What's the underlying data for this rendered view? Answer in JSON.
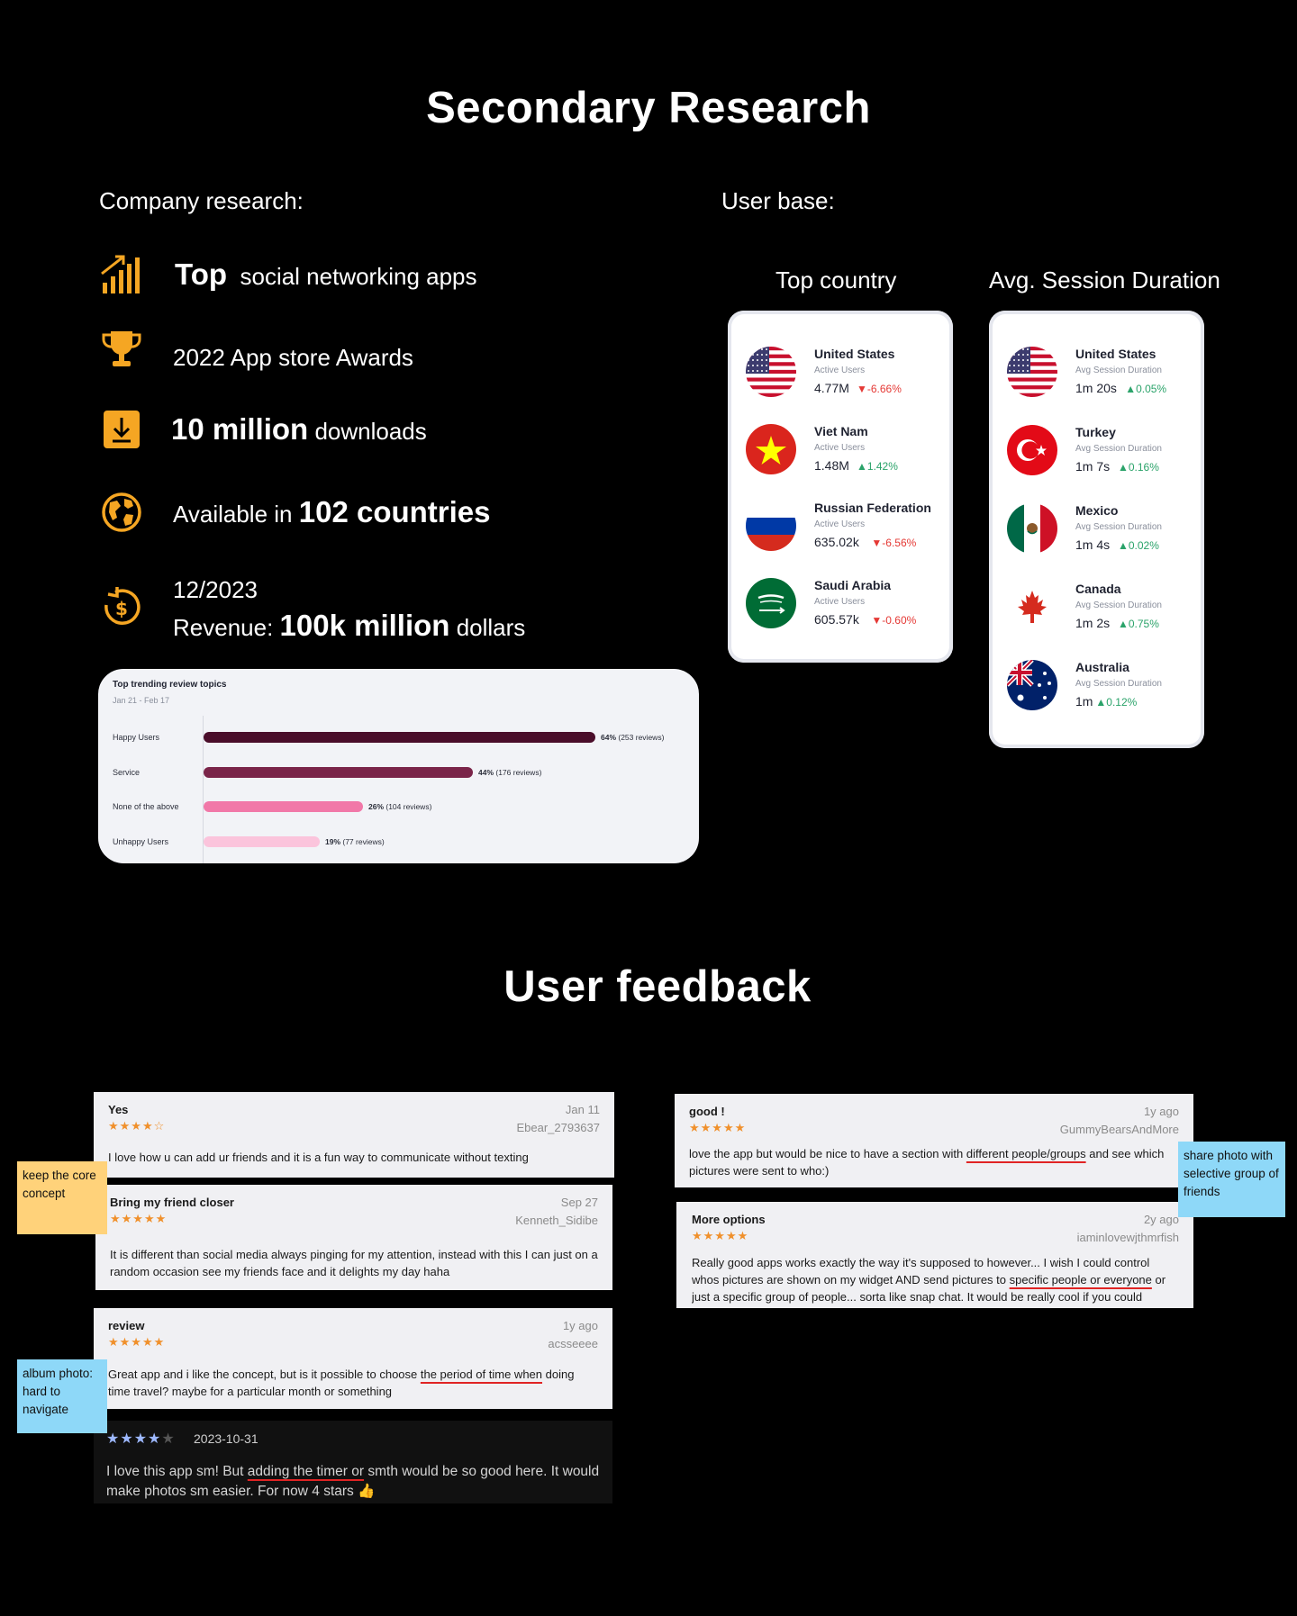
{
  "secondary": {
    "title": "Secondary Research",
    "company_label": "Company research:",
    "userbase_label": "User base:",
    "company_items": [
      {
        "icon": "growth-chart-icon",
        "bold": "Top",
        "text": "social networking apps"
      },
      {
        "icon": "trophy-icon",
        "text": "2022 App store Awards"
      },
      {
        "icon": "download-icon",
        "bold": "10 million",
        "text": "downloads"
      },
      {
        "icon": "globe-icon",
        "prefix": "Available in",
        "bold": "102 countries"
      },
      {
        "icon": "revenue-icon",
        "line1": "12/2023",
        "prefix": "Revenue:",
        "bold": "100k million",
        "text": "dollars"
      }
    ],
    "review_topics": {
      "title": "Top trending review topics",
      "range": "Jan 21 - Feb 17",
      "rows": [
        {
          "label": "Happy Users",
          "pct": "64%",
          "count": "(253 reviews)",
          "value": 64,
          "color": "#4a0d2a"
        },
        {
          "label": "Service",
          "pct": "44%",
          "count": "(176 reviews)",
          "value": 44,
          "color": "#7a2449"
        },
        {
          "label": "None of the above",
          "pct": "26%",
          "count": "(104 reviews)",
          "value": 26,
          "color": "#f178a8"
        },
        {
          "label": "Unhappy Users",
          "pct": "19%",
          "count": "(77 reviews)",
          "value": 19,
          "color": "#fbc4dc"
        }
      ]
    },
    "top_country": {
      "heading": "Top country",
      "rows": [
        {
          "name": "United States",
          "metric": "Active Users",
          "value": "4.77M",
          "change": "▼-6.66%",
          "dir": "down",
          "flag": "us"
        },
        {
          "name": "Viet Nam",
          "metric": "Active Users",
          "value": "1.48M",
          "change": "▲1.42%",
          "dir": "up",
          "flag": "vn"
        },
        {
          "name": "Russian Federation",
          "metric": "Active Users",
          "value": "635.02k",
          "change": "▼-6.56%",
          "dir": "down",
          "flag": "ru"
        },
        {
          "name": "Saudi Arabia",
          "metric": "Active Users",
          "value": "605.57k",
          "change": "▼-0.60%",
          "dir": "down",
          "flag": "sa"
        }
      ]
    },
    "session": {
      "heading": "Avg. Session Duration",
      "rows": [
        {
          "name": "United States",
          "metric": "Avg Session Duration",
          "value": "1m 20s",
          "change": "▲0.05%",
          "dir": "up",
          "flag": "us"
        },
        {
          "name": "Turkey",
          "metric": "Avg Session Duration",
          "value": "1m 7s",
          "change": "▲0.16%",
          "dir": "up",
          "flag": "tr"
        },
        {
          "name": "Mexico",
          "metric": "Avg Session Duration",
          "value": "1m 4s",
          "change": "▲0.02%",
          "dir": "up",
          "flag": "mx"
        },
        {
          "name": "Canada",
          "metric": "Avg Session Duration",
          "value": "1m 2s",
          "change": "▲0.75%",
          "dir": "up",
          "flag": "ca"
        },
        {
          "name": "Australia",
          "metric": "Avg Session Duration",
          "value": "1m",
          "change": "▲0.12%",
          "dir": "up",
          "flag": "au"
        }
      ]
    }
  },
  "feedback": {
    "title": "User feedback",
    "left": [
      {
        "title": "Yes",
        "date": "Jan 11",
        "stars": "★★★★☆",
        "author": "Ebear_2793637",
        "body": "I love how u can add ur friends and it is a fun way to communicate without texting"
      },
      {
        "title": "Bring my friend closer",
        "date": "Sep 27",
        "stars": "★★★★★",
        "author": "Kenneth_Sidibe",
        "body": "It is different than social media always pinging for my attention, instead with this I can just on a random occasion see my friends face and it delights my day haha"
      },
      {
        "title": "review",
        "date": "1y ago",
        "stars": "★★★★★",
        "author": "acsseeee",
        "body_pre": "Great app and i like the concept, but is it possible to choose ",
        "body_ul": "the period of time when",
        "body_post": " doing time travel? maybe for a particular month or something"
      }
    ],
    "dark": {
      "stars": "★★★★★",
      "date": "2023-10-31",
      "body_pre": "I love this app sm! But ",
      "body_ul": "adding the timer or",
      "body_post": " smth would be so good here. It would make photos sm easier. For now 4 stars 👍"
    },
    "right": [
      {
        "title": "good !",
        "date": "1y ago",
        "stars": "★★★★★",
        "author": "GummyBearsAndMore",
        "body_pre": "love the app but would be nice to have a section with ",
        "body_ul": "different people/groups",
        "body_post": " and see which pictures were sent to who:)"
      },
      {
        "title": "More options",
        "date": "2y ago",
        "stars": "★★★★★",
        "author": "iaminlovewjthmrfish",
        "body_pre": "Really good apps works exactly the way it's supposed to however... I wish I could control whos pictures are shown on my widget AND send pictures to ",
        "body_ul": "specific people or everyone",
        "body_post": " or just a specific group of people... sorta like snap chat. It would be really cool if you could"
      }
    ],
    "notes": {
      "keep": "keep the core concept",
      "album": "album photo: hard to navigate",
      "share": "share photo with selective group of friends"
    }
  }
}
